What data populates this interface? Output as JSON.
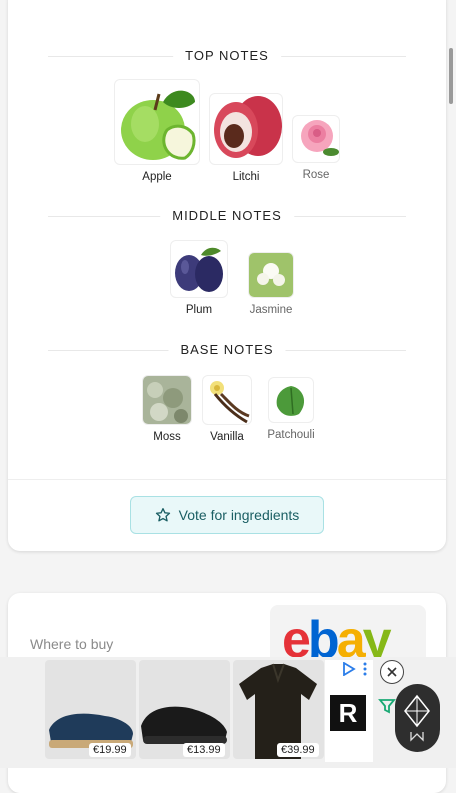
{
  "notes": {
    "top": {
      "label": "TOP NOTES",
      "items": [
        {
          "name": "Apple"
        },
        {
          "name": "Litchi"
        },
        {
          "name": "Rose"
        }
      ]
    },
    "middle": {
      "label": "MIDDLE NOTES",
      "items": [
        {
          "name": "Plum"
        },
        {
          "name": "Jasmine"
        }
      ]
    },
    "base": {
      "label": "BASE NOTES",
      "items": [
        {
          "name": "Moss"
        },
        {
          "name": "Vanilla"
        },
        {
          "name": "Patchouli"
        }
      ]
    }
  },
  "vote": {
    "label": "Vote for ingredients",
    "icon": "star-outline-icon"
  },
  "where_to_buy": {
    "label": "Where to buy",
    "store": "ebay"
  },
  "ad": {
    "products": [
      {
        "price": "€19.99",
        "item": "espadrille"
      },
      {
        "price": "€13.99",
        "item": "sneaker"
      },
      {
        "price": "€39.99",
        "item": "polo-shirt"
      }
    ],
    "brand_letter": "R"
  },
  "colors": {
    "accent": "#1a5e63",
    "ebay_e": "#e53238",
    "ebay_b": "#0064d2",
    "ebay_a": "#f5af02",
    "ebay_y": "#86b817"
  }
}
